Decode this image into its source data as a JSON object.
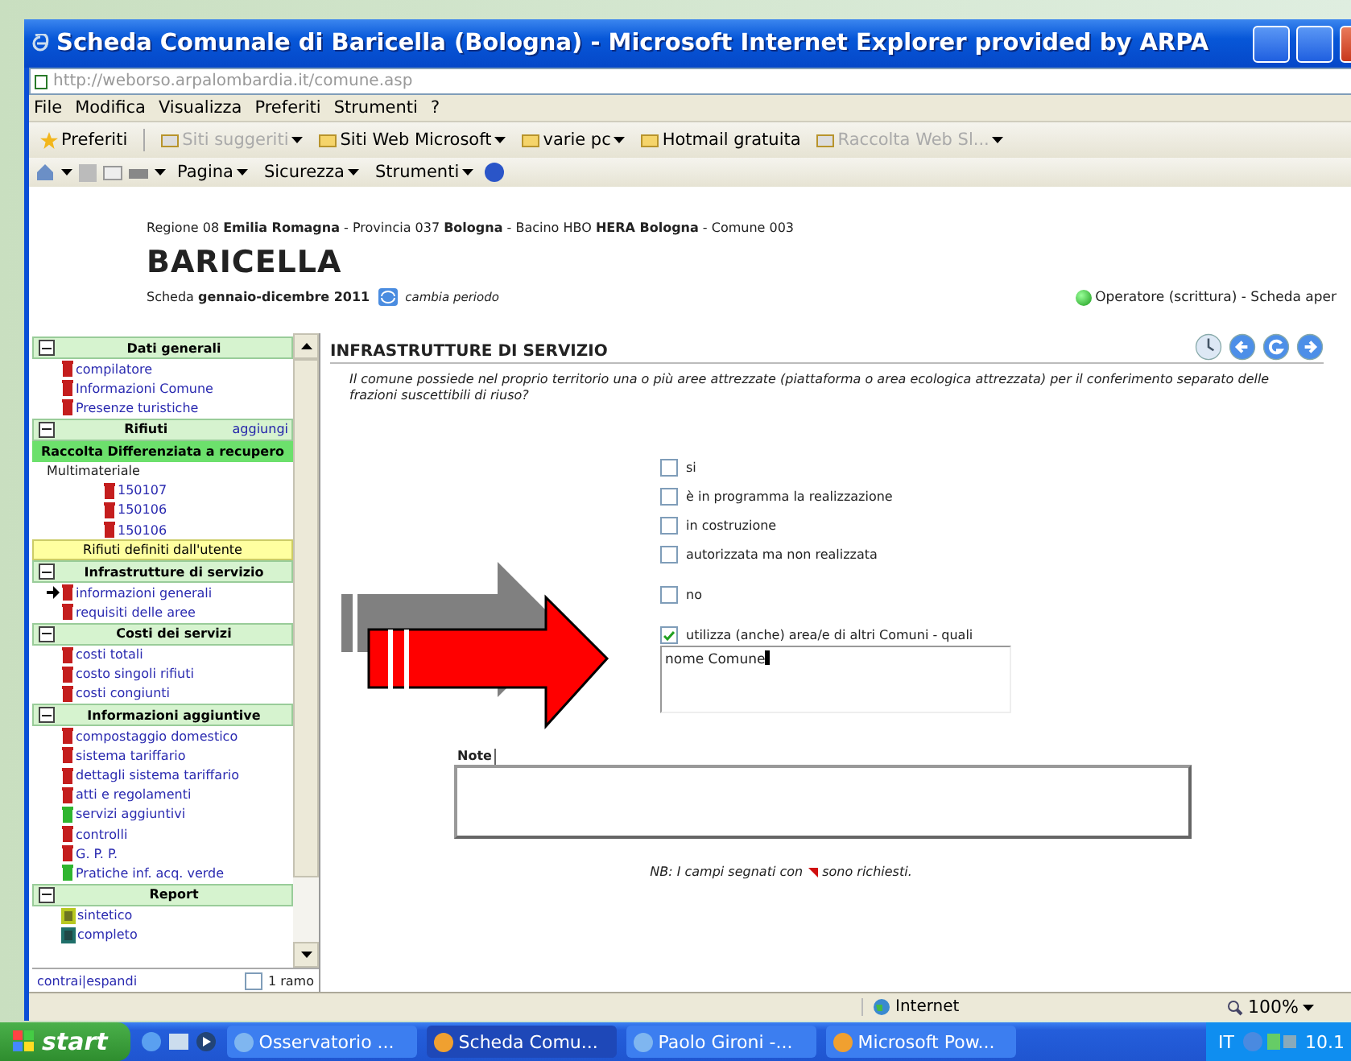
{
  "window": {
    "title": "Scheda Comunale di Baricella (Bologna) - Microsoft Internet Explorer provided by ARPA"
  },
  "address": "http://weborso.arpalombardia.it/comune.asp",
  "menu": [
    "File",
    "Modifica",
    "Visualizza",
    "Preferiti",
    "Strumenti",
    "?"
  ],
  "favorites_bar": {
    "label": "Preferiti",
    "items": [
      {
        "label": "Siti suggeriti",
        "disabled": true,
        "dropdown": true
      },
      {
        "label": "Siti Web Microsoft",
        "disabled": false,
        "dropdown": true
      },
      {
        "label": "varie pc",
        "disabled": false,
        "dropdown": true
      },
      {
        "label": "Hotmail gratuita",
        "disabled": false,
        "dropdown": false
      },
      {
        "label": "Raccolta Web Sl...",
        "disabled": true,
        "dropdown": true
      }
    ]
  },
  "command_bar": [
    "Pagina",
    "Sicurezza",
    "Strumenti"
  ],
  "page": {
    "breadcrumb": "Regione 08 **Emilia Romagna** - Provincia 037 **Bologna** - Bacino HBO **HERA Bologna** - Comune 003",
    "title": "BARICELLA",
    "period": "Scheda **gennaio-dicembre 2011**",
    "change_period": "cambia periodo",
    "operator": "Operatore (scrittura) - Scheda aper"
  },
  "sidebar": {
    "sections": [
      {
        "title": "Dati generali",
        "expanded": true,
        "items": [
          {
            "kind": "link",
            "label": "compilatore",
            "color": "#c41e1e",
            "selected": false
          },
          {
            "kind": "link",
            "label": "Informazioni Comune",
            "color": "#c41e1e",
            "selected": false
          },
          {
            "kind": "link",
            "label": "Presenze turistiche",
            "color": "#c41e1e",
            "selected": false
          }
        ]
      },
      {
        "title": "Rifiuti",
        "expanded": true,
        "action": "aggiungi",
        "items": [
          {
            "kind": "subheader",
            "label": "Raccolta Differenziata a recupero"
          },
          {
            "kind": "label",
            "label": "Multimateriale"
          },
          {
            "kind": "sublink",
            "label": "150107",
            "color": "#c41e1e",
            "selected": false
          },
          {
            "kind": "sublink",
            "label": "150106",
            "color": "#c41e1e",
            "selected": false
          },
          {
            "kind": "sublink",
            "label": "150106",
            "color": "#c41e1e",
            "selected": false
          },
          {
            "kind": "user",
            "label": "Rifiuti definiti dall'utente"
          }
        ]
      },
      {
        "title": "Infrastrutture di servizio",
        "expanded": true,
        "items": [
          {
            "kind": "link",
            "label": "informazioni generali",
            "color": "#c41e1e",
            "selected": true
          },
          {
            "kind": "link",
            "label": "requisiti delle aree",
            "color": "#c41e1e",
            "selected": false
          }
        ]
      },
      {
        "title": "Costi dei servizi",
        "expanded": true,
        "items": [
          {
            "kind": "link",
            "label": "costi totali",
            "color": "#c41e1e",
            "selected": false
          },
          {
            "kind": "link",
            "label": "costo singoli rifiuti",
            "color": "#c41e1e",
            "selected": false
          },
          {
            "kind": "link",
            "label": "costi congiunti",
            "color": "#c41e1e",
            "selected": false
          }
        ]
      },
      {
        "title": "Informazioni aggiuntive",
        "expanded": true,
        "items": [
          {
            "kind": "link",
            "label": "compostaggio domestico",
            "color": "#c41e1e",
            "selected": false
          },
          {
            "kind": "link",
            "label": "sistema tariffario",
            "color": "#c41e1e",
            "selected": false
          },
          {
            "kind": "link",
            "label": "dettagli sistema tariffario",
            "color": "#c41e1e",
            "selected": false
          },
          {
            "kind": "link",
            "label": "atti e regolamenti",
            "color": "#c41e1e",
            "selected": false
          },
          {
            "kind": "link",
            "label": "servizi aggiuntivi",
            "color": "#2fb52f",
            "selected": false
          },
          {
            "kind": "link",
            "label": "controlli",
            "color": "#c41e1e",
            "selected": false
          },
          {
            "kind": "link",
            "label": "G. P. P.",
            "color": "#c41e1e",
            "selected": false
          },
          {
            "kind": "link",
            "label": "Pratiche inf. acq. verde",
            "color": "#2fb52f",
            "selected": false
          }
        ]
      },
      {
        "title": "Report",
        "expanded": true,
        "items": [
          {
            "kind": "report",
            "label": "sintetico",
            "color": "#b8c820",
            "selected": false
          },
          {
            "kind": "report",
            "label": "completo",
            "color": "#1f6f6a",
            "selected": false
          }
        ]
      }
    ],
    "footer": {
      "link": "contrai|espandi",
      "option": {
        "label": "1 ramo",
        "checked": false
      }
    }
  },
  "content": {
    "heading": "INFRASTRUTTURE DI SERVIZIO",
    "question": "Il comune possiede nel proprio territorio una o più aree attrezzate (piattaforma o area ecologica attrezzata) per il conferimento separato delle frazioni suscettibili di riuso?",
    "option_groups": [
      {
        "options": [
          {
            "label": "si",
            "checked": false
          },
          {
            "label": "è in programma la realizzazione",
            "checked": false
          },
          {
            "label": "in costruzione",
            "checked": false
          },
          {
            "label": "autorizzata ma non realizzata",
            "checked": false
          }
        ]
      },
      {
        "options": [
          {
            "label": "no",
            "checked": false
          }
        ]
      },
      {
        "options": [
          {
            "label": "utilizza (anche) area/e di altri Comuni - quali",
            "checked": true
          }
        ]
      }
    ],
    "which_field": {
      "value": "nome Comune"
    },
    "note": {
      "label": "Note"
    },
    "footnote_before": "NB: I campi segnati con",
    "footnote_after": "sono richiesti."
  },
  "status_bar": {
    "zone": "Internet",
    "zoom": "100%"
  },
  "taskbar": {
    "start": "start",
    "tasks": [
      {
        "label": "Osservatorio ...",
        "selected": false
      },
      {
        "label": "Scheda Comu...",
        "selected": true
      },
      {
        "label": "Paolo Gironi -...",
        "selected": false
      },
      {
        "label": "Microsoft Pow...",
        "selected": false
      }
    ],
    "language": "IT",
    "clock": "10.1"
  }
}
